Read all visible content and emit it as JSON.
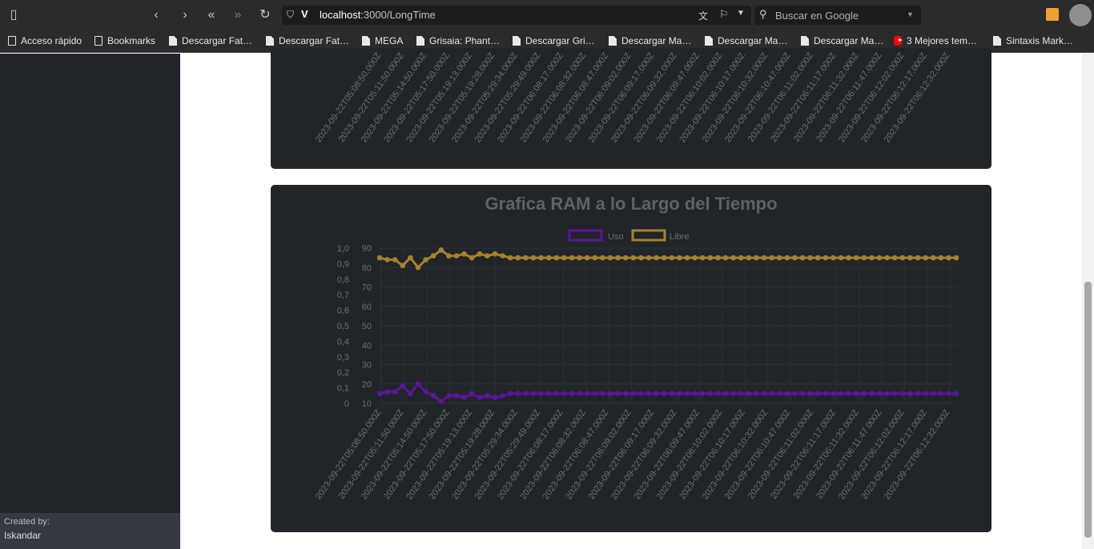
{
  "browser": {
    "url_host": "localhost",
    "url_path": ":3000/LongTime",
    "search_placeholder": "Buscar en Google"
  },
  "bookmarks": [
    {
      "label": "Acceso rápido",
      "icon": "quick-access-icon"
    },
    {
      "label": "Bookmarks",
      "icon": "folder-icon"
    },
    {
      "label": "Descargar Fat…",
      "icon": "page-icon"
    },
    {
      "label": "Descargar Fat…",
      "icon": "page-icon"
    },
    {
      "label": "MEGA",
      "icon": "page-icon"
    },
    {
      "label": "Grisaia: Phant…",
      "icon": "page-icon"
    },
    {
      "label": "Descargar Gri…",
      "icon": "page-icon"
    },
    {
      "label": "Descargar Ma…",
      "icon": "page-icon"
    },
    {
      "label": "Descargar Ma…",
      "icon": "page-icon"
    },
    {
      "label": "Descargar Ma…",
      "icon": "page-icon"
    },
    {
      "label": "3 Mejores tem…",
      "icon": "youtube-icon"
    },
    {
      "label": "Sintaxis Mark…",
      "icon": "page-icon"
    }
  ],
  "sidebar": {
    "credit_label": "Created by:",
    "credit_name": "Iskandar"
  },
  "colors": {
    "uso": "#5b159a",
    "libre": "#a8822a",
    "card_bg": "#212529",
    "text_muted": "#6c6f73"
  },
  "chart_data": [
    {
      "type": "line",
      "note_visible": "partial top chart, only x tick labels visible",
      "x": [
        "2023-09-22T05:08:50.000Z",
        "2023-09-22T05:11:50.000Z",
        "2023-09-22T05:14:50.000Z",
        "2023-09-22T05:17:50.000Z",
        "2023-09-22T05:19:13.000Z",
        "2023-09-22T05:19:28.000Z",
        "2023-09-22T05:29:34.000Z",
        "2023-09-22T05:29:49.000Z",
        "2023-09-22T06:08:17.000Z",
        "2023-09-22T06:08:32.000Z",
        "2023-09-22T06:08:47.000Z",
        "2023-09-22T06:09:02.000Z",
        "2023-09-22T06:09:17.000Z",
        "2023-09-22T06:09:32.000Z",
        "2023-09-22T06:09:47.000Z",
        "2023-09-22T06:10:02.000Z",
        "2023-09-22T06:10:17.000Z",
        "2023-09-22T06:10:32.000Z",
        "2023-09-22T06:10:47.000Z",
        "2023-09-22T06:11:02.000Z",
        "2023-09-22T06:11:17.000Z",
        "2023-09-22T06:11:32.000Z",
        "2023-09-22T06:11:47.000Z",
        "2023-09-22T06:12:02.000Z",
        "2023-09-22T06:12:17.000Z",
        "2023-09-22T06:12:32.000Z"
      ]
    },
    {
      "type": "line",
      "title": "Grafica RAM a lo Largo del Tiempo",
      "y_left_ticks": [
        "1,0",
        "0,9",
        "0,8",
        "0,7",
        "0,6",
        "0,5",
        "0,4",
        "0,3",
        "0,2",
        "0,1",
        "0"
      ],
      "y_right_ticks": [
        "90",
        "80",
        "70",
        "60",
        "50",
        "40",
        "30",
        "20",
        "10"
      ],
      "ylim": [
        10,
        90
      ],
      "grid": true,
      "legend_position": "top",
      "x": [
        "2023-09-22T05:08:50.000Z",
        "2023-09-22T05:11:50.000Z",
        "2023-09-22T05:14:50.000Z",
        "2023-09-22T05:17:50.000Z",
        "2023-09-22T05:19:13.000Z",
        "2023-09-22T05:19:28.000Z",
        "2023-09-22T05:29:34.000Z",
        "2023-09-22T05:29:49.000Z",
        "2023-09-22T06:08:17.000Z",
        "2023-09-22T06:08:32.000Z",
        "2023-09-22T06:08:47.000Z",
        "2023-09-22T06:09:02.000Z",
        "2023-09-22T06:09:17.000Z",
        "2023-09-22T06:09:32.000Z",
        "2023-09-22T06:09:47.000Z",
        "2023-09-22T06:10:02.000Z",
        "2023-09-22T06:10:17.000Z",
        "2023-09-22T06:10:32.000Z",
        "2023-09-22T06:10:47.000Z",
        "2023-09-22T06:11:02.000Z",
        "2023-09-22T06:11:17.000Z",
        "2023-09-22T06:11:32.000Z",
        "2023-09-22T06:11:47.000Z",
        "2023-09-22T06:12:02.000Z",
        "2023-09-22T06:12:17.000Z",
        "2023-09-22T06:12:32.000Z"
      ],
      "series": [
        {
          "name": "Uso",
          "color": "#5b159a",
          "values": [
            15,
            16,
            16,
            19,
            15,
            20,
            16,
            14,
            11,
            14,
            14,
            13,
            15,
            13,
            14,
            13,
            14,
            15,
            15,
            15,
            15,
            15,
            15,
            15,
            15,
            15,
            15,
            15,
            15,
            15,
            15,
            15,
            15,
            15,
            15,
            15,
            15,
            15,
            15,
            15,
            15,
            15,
            15,
            15,
            15,
            15,
            15,
            15,
            15,
            15,
            15,
            15,
            15,
            15,
            15,
            15,
            15,
            15,
            15,
            15,
            15,
            15,
            15,
            15,
            15,
            15,
            15,
            15,
            15,
            15,
            15,
            15,
            15,
            15,
            15,
            15
          ]
        },
        {
          "name": "Libre",
          "color": "#a8822a",
          "values": [
            85,
            84,
            84,
            81,
            85,
            80,
            84,
            86,
            89,
            86,
            86,
            87,
            85,
            87,
            86,
            87,
            86,
            85,
            85,
            85,
            85,
            85,
            85,
            85,
            85,
            85,
            85,
            85,
            85,
            85,
            85,
            85,
            85,
            85,
            85,
            85,
            85,
            85,
            85,
            85,
            85,
            85,
            85,
            85,
            85,
            85,
            85,
            85,
            85,
            85,
            85,
            85,
            85,
            85,
            85,
            85,
            85,
            85,
            85,
            85,
            85,
            85,
            85,
            85,
            85,
            85,
            85,
            85,
            85,
            85,
            85,
            85,
            85,
            85,
            85,
            85
          ]
        }
      ]
    }
  ]
}
